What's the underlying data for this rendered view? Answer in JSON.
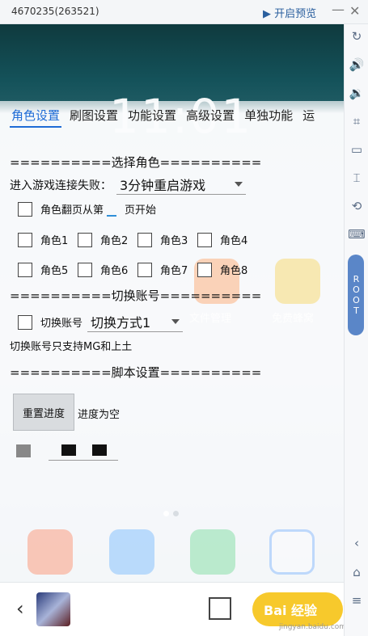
{
  "window": {
    "title": "4670235(263521)",
    "preview_label": "▶ 开启预览",
    "min_icon": "minimize-icon",
    "close_icon": "close-icon"
  },
  "screen": {
    "clock": "11:01",
    "background_apps": [
      "文件管理",
      "免费蜂窝"
    ]
  },
  "tabs": [
    {
      "label": "角色设置",
      "active": true
    },
    {
      "label": "刷图设置",
      "active": false
    },
    {
      "label": "功能设置",
      "active": false
    },
    {
      "label": "高级设置",
      "active": false
    },
    {
      "label": "单独功能",
      "active": false
    },
    {
      "label": "运",
      "active": false
    }
  ],
  "sections": {
    "choose_role": "==========选择角色==========",
    "switch_account": "==========切换账号==========",
    "script_settings": "==========脚本设置=========="
  },
  "reconnect": {
    "label": "进入游戏连接失败：",
    "value": "3分钟重启游戏"
  },
  "role_page": {
    "label_before": "角色翻页从第",
    "value": "",
    "label_after": "页开始"
  },
  "roles": [
    "角色1",
    "角色2",
    "角色3",
    "角色4",
    "角色5",
    "角色6",
    "角色7",
    "角色8"
  ],
  "switch": {
    "checkbox_label": "切换账号",
    "mode_value": "切换方式1",
    "note": "切换账号只支持MG和上土"
  },
  "reset": {
    "button_label": "重置进度",
    "status": "进度为空"
  },
  "bottombar": {
    "back_icon": "back-arrow-icon",
    "shrink_icon": "shrink-icon",
    "baidu_label": "Bai 经验",
    "baidu_sub": "jingyan.baidu.com"
  },
  "sidebar": {
    "icons": [
      "refresh-icon",
      "volume-up-icon",
      "volume-down-icon",
      "crop-icon",
      "folder-icon",
      "scan-icon",
      "rotate-icon",
      "keyboard-icon"
    ],
    "root_label": "ROOT",
    "bottom_icons": [
      "chevron-left-icon",
      "home-icon",
      "menu-icon"
    ]
  },
  "colors": {
    "accent": "#1e6bd6",
    "teal_header": "#14525a",
    "baidu_yellow": "#f7c92c",
    "root_blue": "#5a86c8"
  }
}
